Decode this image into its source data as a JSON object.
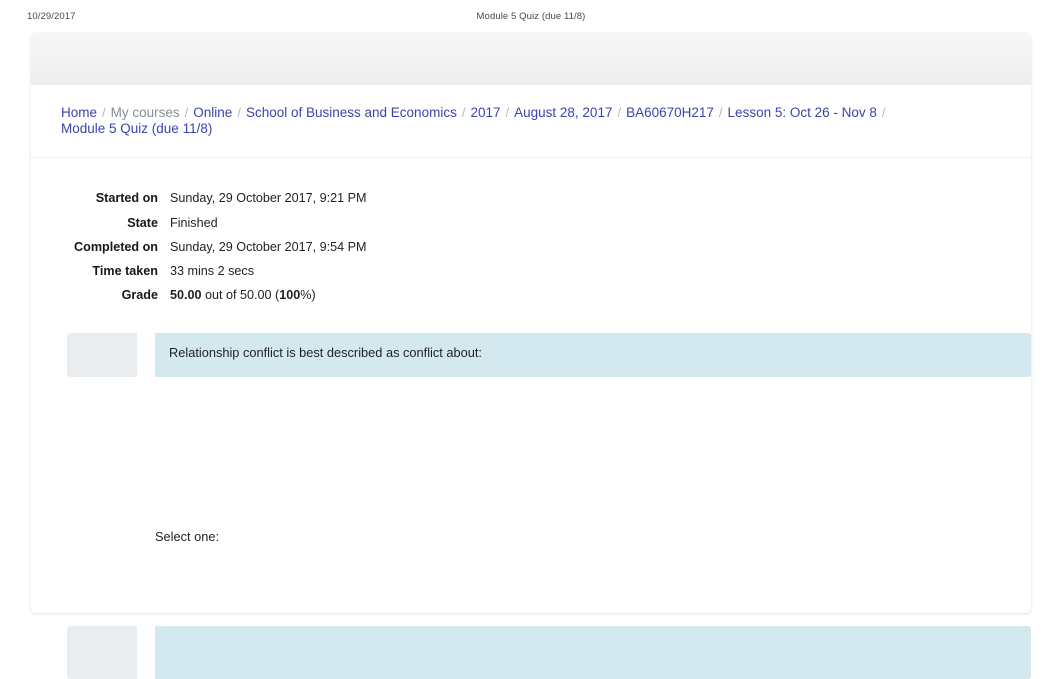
{
  "print_header": {
    "date": "10/29/2017",
    "title": "Module 5 Quiz (due 11/8)"
  },
  "breadcrumb": {
    "separator": "/",
    "items": [
      {
        "label": "Home",
        "muted": false
      },
      {
        "label": "My courses",
        "muted": true
      },
      {
        "label": "Online",
        "muted": false
      },
      {
        "label": "School of Business and Economics",
        "muted": false
      },
      {
        "label": "2017",
        "muted": false
      },
      {
        "label": "August 28, 2017",
        "muted": false
      },
      {
        "label": "BA60670H217",
        "muted": false
      },
      {
        "label": "Lesson 5: Oct 26 - Nov 8",
        "muted": false
      },
      {
        "label": "Module 5 Quiz (due 11/8)",
        "muted": false
      }
    ]
  },
  "summary": {
    "rows": [
      {
        "label": "Started on",
        "value": "Sunday, 29 October 2017, 9:21 PM"
      },
      {
        "label": "State",
        "value": "Finished"
      },
      {
        "label": "Completed on",
        "value": "Sunday, 29 October 2017, 9:54 PM"
      },
      {
        "label": "Time taken",
        "value": "33 mins 2 secs"
      }
    ],
    "grade": {
      "label": "Grade",
      "score": "50.00",
      "middle": " out of 50.00 (",
      "percent": "100",
      "suffix": "%)"
    }
  },
  "question": {
    "text": "Relationship conflict is best described as conflict about:",
    "select_one_label": "Select one:"
  },
  "colors": {
    "link": "#3b44ac",
    "muted_link": "#868e96",
    "question_bg": "#d4e8f0",
    "info_bg": "#e9edef",
    "card_band": "#f1f2f3",
    "text": "#1d2125"
  }
}
